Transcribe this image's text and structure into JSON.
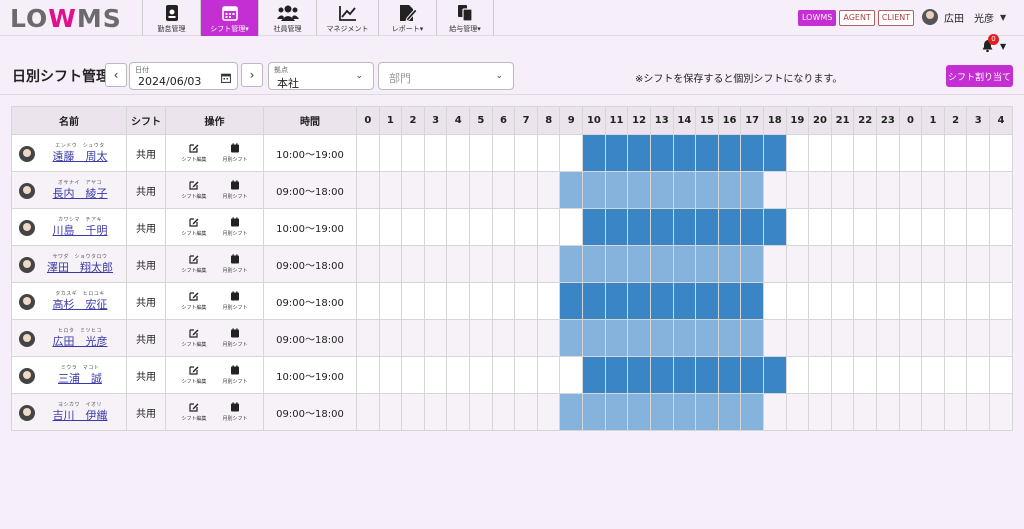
{
  "app": {
    "logo": {
      "pre": "LO",
      "mark": "W",
      "post": "MS"
    },
    "nav": [
      {
        "label": "勤怠管理",
        "icon": "id-badge-icon"
      },
      {
        "label": "シフト管理▾",
        "icon": "calendar-icon",
        "active": true
      },
      {
        "label": "社員管理",
        "icon": "users-icon"
      },
      {
        "label": "マネジメント",
        "icon": "chart-line-icon"
      },
      {
        "label": "レポート▾",
        "icon": "file-edit-icon"
      },
      {
        "label": "給与管理▾",
        "icon": "copy-icon"
      }
    ],
    "roles": [
      "LOWMS",
      "AGENT",
      "CLIENT"
    ],
    "user": {
      "name": "広田　光彦"
    },
    "notifications": {
      "count": "0"
    }
  },
  "toolbar": {
    "title": "日別シフト管理",
    "date_label": "日付",
    "date_value": "2024/06/03",
    "base_label": "拠点",
    "base_value": "本社",
    "dept_placeholder": "部門",
    "note": "※シフトを保存すると個別シフトになります。",
    "assign_button": "シフト割り当て"
  },
  "table": {
    "headers": {
      "name": "名前",
      "shift": "シフト",
      "ops": "操作",
      "time": "時間"
    },
    "hours": [
      "0",
      "1",
      "2",
      "3",
      "4",
      "5",
      "6",
      "7",
      "8",
      "9",
      "10",
      "11",
      "12",
      "13",
      "14",
      "15",
      "16",
      "17",
      "18",
      "19",
      "20",
      "21",
      "22",
      "23",
      "0",
      "1",
      "2",
      "3",
      "4"
    ],
    "op_labels": {
      "edit": "シフト編集",
      "monthly": "月別シフト"
    },
    "rows": [
      {
        "kana": "エンドウ　シュウタ",
        "name": "遠藤　周太",
        "shift": "共用",
        "time": "10:00〜19:00",
        "start": 10,
        "end": 19,
        "tone": "dark"
      },
      {
        "kana": "オサナイ　アヤコ",
        "name": "長内　綾子",
        "shift": "共用",
        "time": "09:00〜18:00",
        "start": 9,
        "end": 18,
        "tone": "light"
      },
      {
        "kana": "カワシマ　チアキ",
        "name": "川島　千明",
        "shift": "共用",
        "time": "10:00〜19:00",
        "start": 10,
        "end": 19,
        "tone": "dark"
      },
      {
        "kana": "サワダ　ショウタロウ",
        "name": "澤田　翔太郎",
        "shift": "共用",
        "time": "09:00〜18:00",
        "start": 9,
        "end": 18,
        "tone": "light"
      },
      {
        "kana": "タカスギ　ヒロユキ",
        "name": "高杉　宏征",
        "shift": "共用",
        "time": "09:00〜18:00",
        "start": 9,
        "end": 18,
        "tone": "dark"
      },
      {
        "kana": "ヒロタ　ミツヒコ",
        "name": "広田　光彦",
        "shift": "共用",
        "time": "09:00〜18:00",
        "start": 9,
        "end": 18,
        "tone": "light"
      },
      {
        "kana": "ミウラ　マコト",
        "name": "三浦　誠",
        "shift": "共用",
        "time": "10:00〜19:00",
        "start": 10,
        "end": 19,
        "tone": "dark"
      },
      {
        "kana": "ヨシカワ　イオリ",
        "name": "吉川　伊織",
        "shift": "共用",
        "time": "09:00〜18:00",
        "start": 9,
        "end": 18,
        "tone": "light"
      }
    ]
  }
}
